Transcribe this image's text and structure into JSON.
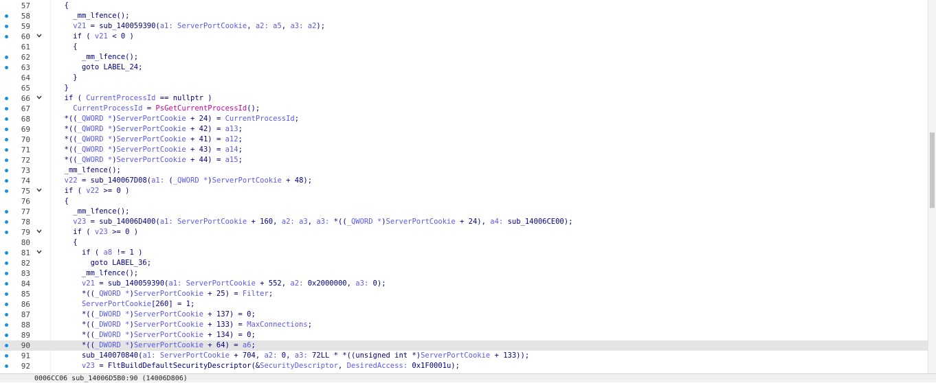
{
  "editor": {
    "highlighted_line": "90",
    "lines": [
      {
        "num": "57",
        "bp": false,
        "fold": false,
        "indent": "  ",
        "tokens": [
          [
            "p",
            "{"
          ]
        ]
      },
      {
        "num": "58",
        "bp": true,
        "fold": false,
        "indent": "    ",
        "tokens": [
          [
            "k",
            "_mm_lfence();"
          ]
        ]
      },
      {
        "num": "59",
        "bp": true,
        "fold": false,
        "indent": "    ",
        "tokens": [
          [
            "v",
            "v21"
          ],
          [
            "k",
            " = sub_140059390("
          ],
          [
            "v",
            "a1: "
          ],
          [
            "v",
            "ServerPortCookie"
          ],
          [
            "k",
            ", "
          ],
          [
            "v",
            "a2: "
          ],
          [
            "v",
            "a5"
          ],
          [
            "k",
            ", "
          ],
          [
            "v",
            "a3: "
          ],
          [
            "v",
            "a2"
          ],
          [
            "k",
            ");"
          ]
        ]
      },
      {
        "num": "60",
        "bp": true,
        "fold": true,
        "indent": "    ",
        "tokens": [
          [
            "k",
            "if ( "
          ],
          [
            "v",
            "v21"
          ],
          [
            "k",
            " < 0 )"
          ]
        ]
      },
      {
        "num": "61",
        "bp": false,
        "fold": false,
        "indent": "    ",
        "tokens": [
          [
            "k",
            "{"
          ]
        ]
      },
      {
        "num": "62",
        "bp": true,
        "fold": false,
        "indent": "      ",
        "tokens": [
          [
            "k",
            "_mm_lfence();"
          ]
        ]
      },
      {
        "num": "63",
        "bp": true,
        "fold": false,
        "indent": "      ",
        "tokens": [
          [
            "k",
            "goto LABEL_24;"
          ]
        ]
      },
      {
        "num": "64",
        "bp": false,
        "fold": false,
        "indent": "    ",
        "tokens": [
          [
            "k",
            "}"
          ]
        ]
      },
      {
        "num": "65",
        "bp": false,
        "fold": false,
        "indent": "  ",
        "tokens": [
          [
            "k",
            "}"
          ]
        ]
      },
      {
        "num": "66",
        "bp": true,
        "fold": true,
        "indent": "  ",
        "tokens": [
          [
            "k",
            "if ( "
          ],
          [
            "v",
            "CurrentProcessId"
          ],
          [
            "k",
            " == nullptr )"
          ]
        ]
      },
      {
        "num": "67",
        "bp": true,
        "fold": false,
        "indent": "    ",
        "tokens": [
          [
            "v",
            "CurrentProcessId"
          ],
          [
            "k",
            " = "
          ],
          [
            "m",
            "PsGetCurrentProcessId"
          ],
          [
            "k",
            "();"
          ]
        ]
      },
      {
        "num": "68",
        "bp": true,
        "fold": false,
        "indent": "  ",
        "tokens": [
          [
            "k",
            "*(("
          ],
          [
            "v",
            "_QWORD *"
          ],
          [
            "k",
            ")"
          ],
          [
            "v",
            "ServerPortCookie"
          ],
          [
            "k",
            " + 24) = "
          ],
          [
            "v",
            "CurrentProcessId"
          ],
          [
            "k",
            ";"
          ]
        ]
      },
      {
        "num": "69",
        "bp": true,
        "fold": false,
        "indent": "  ",
        "tokens": [
          [
            "k",
            "*(("
          ],
          [
            "v",
            "_QWORD *"
          ],
          [
            "k",
            ")"
          ],
          [
            "v",
            "ServerPortCookie"
          ],
          [
            "k",
            " + 42) = "
          ],
          [
            "v",
            "a13"
          ],
          [
            "k",
            ";"
          ]
        ]
      },
      {
        "num": "70",
        "bp": true,
        "fold": false,
        "indent": "  ",
        "tokens": [
          [
            "k",
            "*(("
          ],
          [
            "v",
            "_QWORD *"
          ],
          [
            "k",
            ")"
          ],
          [
            "v",
            "ServerPortCookie"
          ],
          [
            "k",
            " + 41) = "
          ],
          [
            "v",
            "a12"
          ],
          [
            "k",
            ";"
          ]
        ]
      },
      {
        "num": "71",
        "bp": true,
        "fold": false,
        "indent": "  ",
        "tokens": [
          [
            "k",
            "*(("
          ],
          [
            "v",
            "_QWORD *"
          ],
          [
            "k",
            ")"
          ],
          [
            "v",
            "ServerPortCookie"
          ],
          [
            "k",
            " + 43) = "
          ],
          [
            "v",
            "a14"
          ],
          [
            "k",
            ";"
          ]
        ]
      },
      {
        "num": "72",
        "bp": true,
        "fold": false,
        "indent": "  ",
        "tokens": [
          [
            "k",
            "*(("
          ],
          [
            "v",
            "_QWORD *"
          ],
          [
            "k",
            ")"
          ],
          [
            "v",
            "ServerPortCookie"
          ],
          [
            "k",
            " + 44) = "
          ],
          [
            "v",
            "a15"
          ],
          [
            "k",
            ";"
          ]
        ]
      },
      {
        "num": "73",
        "bp": true,
        "fold": false,
        "indent": "  ",
        "tokens": [
          [
            "k",
            "_mm_lfence();"
          ]
        ]
      },
      {
        "num": "74",
        "bp": true,
        "fold": false,
        "indent": "  ",
        "tokens": [
          [
            "v",
            "v22"
          ],
          [
            "k",
            " = sub_140067D08("
          ],
          [
            "v",
            "a1: "
          ],
          [
            "k",
            "("
          ],
          [
            "v",
            "_QWORD *"
          ],
          [
            "k",
            ")"
          ],
          [
            "v",
            "ServerPortCookie"
          ],
          [
            "k",
            " + 48);"
          ]
        ]
      },
      {
        "num": "75",
        "bp": true,
        "fold": true,
        "indent": "  ",
        "tokens": [
          [
            "k",
            "if ( "
          ],
          [
            "v",
            "v22"
          ],
          [
            "k",
            " >= 0 )"
          ]
        ]
      },
      {
        "num": "76",
        "bp": false,
        "fold": false,
        "indent": "  ",
        "tokens": [
          [
            "k",
            "{"
          ]
        ]
      },
      {
        "num": "77",
        "bp": true,
        "fold": false,
        "indent": "    ",
        "tokens": [
          [
            "k",
            "_mm_lfence();"
          ]
        ]
      },
      {
        "num": "78",
        "bp": true,
        "fold": false,
        "indent": "    ",
        "tokens": [
          [
            "v",
            "v23"
          ],
          [
            "k",
            " = sub_14006D400("
          ],
          [
            "v",
            "a1: "
          ],
          [
            "v",
            "ServerPortCookie"
          ],
          [
            "k",
            " + 160, "
          ],
          [
            "v",
            "a2: "
          ],
          [
            "v",
            "a3"
          ],
          [
            "k",
            ", "
          ],
          [
            "v",
            "a3: "
          ],
          [
            "k",
            "*(("
          ],
          [
            "v",
            "_QWORD *"
          ],
          [
            "k",
            ")"
          ],
          [
            "v",
            "ServerPortCookie"
          ],
          [
            "k",
            " + 24), "
          ],
          [
            "v",
            "a4: "
          ],
          [
            "k",
            "sub_14006CE00);"
          ]
        ]
      },
      {
        "num": "79",
        "bp": true,
        "fold": true,
        "indent": "    ",
        "tokens": [
          [
            "k",
            "if ( "
          ],
          [
            "v",
            "v23"
          ],
          [
            "k",
            " >= 0 )"
          ]
        ]
      },
      {
        "num": "80",
        "bp": false,
        "fold": false,
        "indent": "    ",
        "tokens": [
          [
            "k",
            "{"
          ]
        ]
      },
      {
        "num": "81",
        "bp": true,
        "fold": true,
        "indent": "      ",
        "tokens": [
          [
            "k",
            "if ( "
          ],
          [
            "v",
            "a8"
          ],
          [
            "k",
            " != 1 )"
          ]
        ]
      },
      {
        "num": "82",
        "bp": true,
        "fold": false,
        "indent": "        ",
        "tokens": [
          [
            "k",
            "goto LABEL_36;"
          ]
        ]
      },
      {
        "num": "83",
        "bp": true,
        "fold": false,
        "indent": "      ",
        "tokens": [
          [
            "k",
            "_mm_lfence();"
          ]
        ]
      },
      {
        "num": "84",
        "bp": true,
        "fold": false,
        "indent": "      ",
        "tokens": [
          [
            "v",
            "v21"
          ],
          [
            "k",
            " = sub_140059390("
          ],
          [
            "v",
            "a1: "
          ],
          [
            "v",
            "ServerPortCookie"
          ],
          [
            "k",
            " + 552, "
          ],
          [
            "v",
            "a2: "
          ],
          [
            "k",
            "0x2000000, "
          ],
          [
            "v",
            "a3: "
          ],
          [
            "k",
            "0);"
          ]
        ]
      },
      {
        "num": "85",
        "bp": true,
        "fold": false,
        "indent": "      ",
        "tokens": [
          [
            "k",
            "*(("
          ],
          [
            "v",
            "_QWORD *"
          ],
          [
            "k",
            ")"
          ],
          [
            "v",
            "ServerPortCookie"
          ],
          [
            "k",
            " + 25) = "
          ],
          [
            "v",
            "Filter"
          ],
          [
            "k",
            ";"
          ]
        ]
      },
      {
        "num": "86",
        "bp": true,
        "fold": false,
        "indent": "      ",
        "tokens": [
          [
            "v",
            "ServerPortCookie"
          ],
          [
            "k",
            "[260] = 1;"
          ]
        ]
      },
      {
        "num": "87",
        "bp": true,
        "fold": false,
        "indent": "      ",
        "tokens": [
          [
            "k",
            "*(("
          ],
          [
            "v",
            "_DWORD *"
          ],
          [
            "k",
            ")"
          ],
          [
            "v",
            "ServerPortCookie"
          ],
          [
            "k",
            " + 137) = 0;"
          ]
        ]
      },
      {
        "num": "88",
        "bp": true,
        "fold": false,
        "indent": "      ",
        "tokens": [
          [
            "k",
            "*(("
          ],
          [
            "v",
            "_DWORD *"
          ],
          [
            "k",
            ")"
          ],
          [
            "v",
            "ServerPortCookie"
          ],
          [
            "k",
            " + 133) = "
          ],
          [
            "v",
            "MaxConnections"
          ],
          [
            "k",
            ";"
          ]
        ]
      },
      {
        "num": "89",
        "bp": true,
        "fold": false,
        "indent": "      ",
        "tokens": [
          [
            "k",
            "*(("
          ],
          [
            "v",
            "_DWORD *"
          ],
          [
            "k",
            ")"
          ],
          [
            "v",
            "ServerPortCookie"
          ],
          [
            "k",
            " + 134) = 0;"
          ]
        ]
      },
      {
        "num": "90",
        "bp": true,
        "fold": false,
        "indent": "      ",
        "tokens": [
          [
            "k",
            "*(("
          ],
          [
            "v",
            "_DWORD *"
          ],
          [
            "k",
            ")"
          ],
          [
            "v",
            "ServerPortCookie"
          ],
          [
            "k",
            " + 64) = "
          ],
          [
            "v",
            "a6"
          ],
          [
            "k",
            ";"
          ]
        ]
      },
      {
        "num": "91",
        "bp": true,
        "fold": false,
        "indent": "      ",
        "tokens": [
          [
            "k",
            "sub_140070840("
          ],
          [
            "v",
            "a1: "
          ],
          [
            "v",
            "ServerPortCookie"
          ],
          [
            "k",
            " + 704, "
          ],
          [
            "v",
            "a2: "
          ],
          [
            "k",
            "0, "
          ],
          [
            "v",
            "a3: "
          ],
          [
            "k",
            "72LL * *((unsigned int *)"
          ],
          [
            "v",
            "ServerPortCookie"
          ],
          [
            "k",
            " + 133));"
          ]
        ]
      },
      {
        "num": "92",
        "bp": true,
        "fold": false,
        "indent": "      ",
        "tokens": [
          [
            "v",
            "v23"
          ],
          [
            "k",
            " = FltBuildDefaultSecurityDescriptor(&"
          ],
          [
            "v",
            "SecurityDescriptor"
          ],
          [
            "k",
            ", "
          ],
          [
            "v",
            "DesiredAccess: "
          ],
          [
            "k",
            "0x1F0001u);"
          ]
        ]
      }
    ]
  },
  "status": {
    "text": "0006CC06 sub_14006D5B0:90 (14006D806)"
  },
  "colors": {
    "keyword": "#000080",
    "variable": "#5a5ae8",
    "macro": "#d0009e",
    "breakpoint_dot": "#1a8fe0",
    "highlight": "#e4e4e4"
  }
}
